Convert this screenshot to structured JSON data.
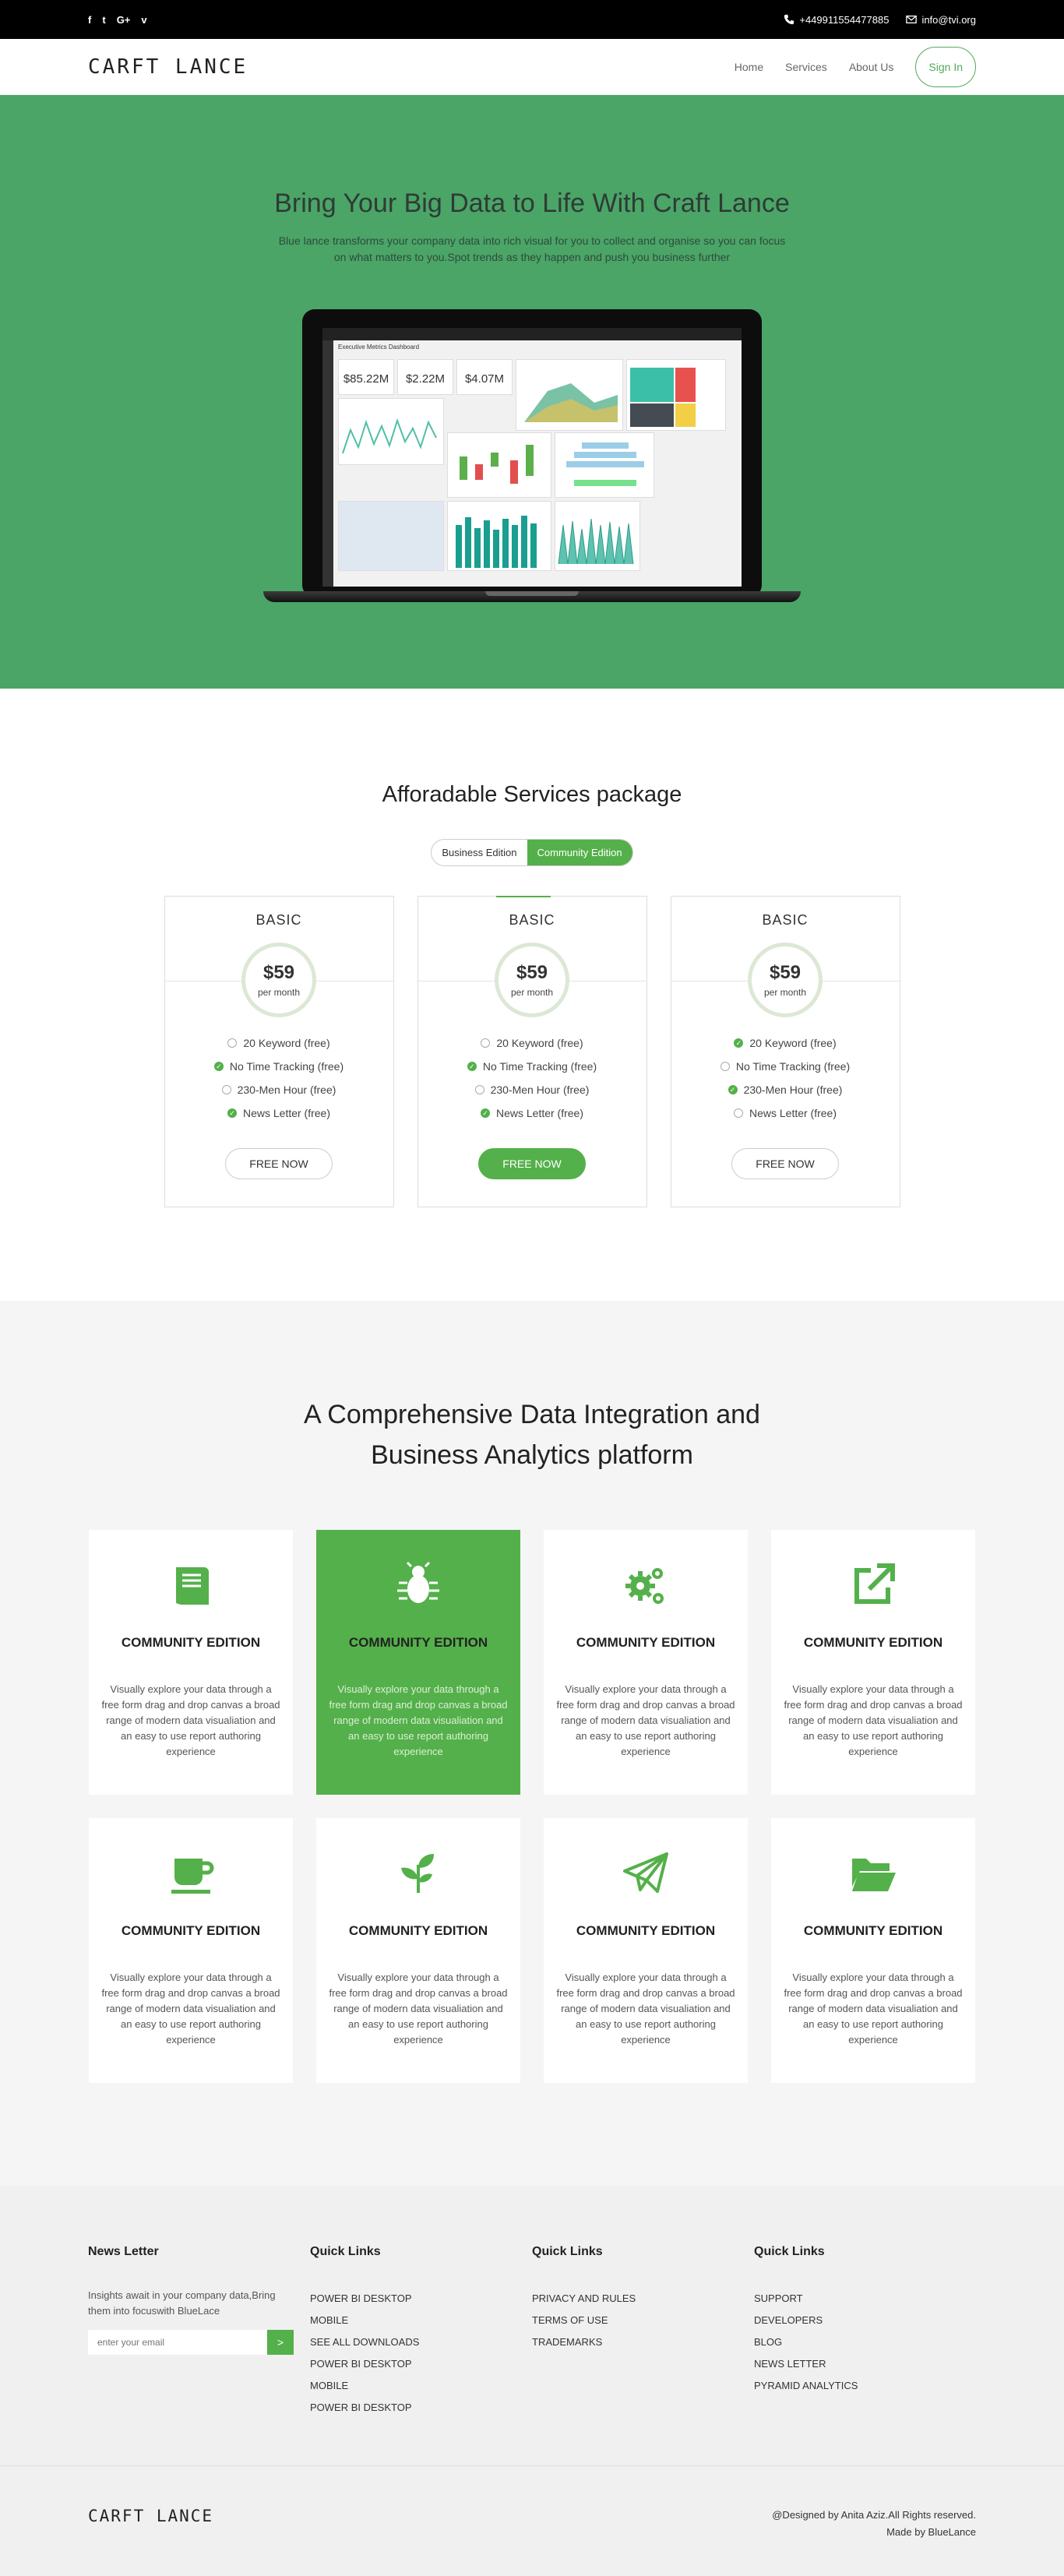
{
  "topbar": {
    "social": [
      {
        "icon": "facebook-icon",
        "glyph": "f"
      },
      {
        "icon": "twitter-icon",
        "glyph": "t"
      },
      {
        "icon": "google-plus-icon",
        "glyph": "G+"
      },
      {
        "icon": "vimeo-icon",
        "glyph": "v"
      }
    ],
    "phone": "+449911554477885",
    "email": "info@tvi.org"
  },
  "nav": {
    "logo": "CARFT LANCE",
    "links": [
      "Home",
      "Services",
      "About Us"
    ],
    "signin": "Sign In"
  },
  "hero": {
    "title": "Bring Your Big Data to Life With Craft Lance",
    "text": "Blue lance transforms your company data into rich visual for you to collect and organise so you can focus on what matters to you.Spot trends as they happen and push you business further",
    "dashboard": {
      "title": "Executive Metrics Dashboard",
      "kpis": [
        "$85.22M",
        "$2.22M",
        "$4.07M"
      ]
    }
  },
  "pricing": {
    "title": "Afforadable Services package",
    "tabs": [
      "Business Edition",
      "Community Edition"
    ],
    "active_tab": 1,
    "plans": [
      {
        "name": "BASIC",
        "price": "$59",
        "period": "per month",
        "features": [
          {
            "text": "20 Keyword (free)",
            "on": false
          },
          {
            "text": "No Time Tracking (free)",
            "on": true
          },
          {
            "text": "230-Men Hour (free)",
            "on": false
          },
          {
            "text": "News Letter (free)",
            "on": true
          }
        ],
        "button": "FREE NOW",
        "featured": false
      },
      {
        "name": "BASIC",
        "price": "$59",
        "period": "per month",
        "features": [
          {
            "text": "20 Keyword (free)",
            "on": false
          },
          {
            "text": "No Time Tracking (free)",
            "on": true
          },
          {
            "text": "230-Men Hour (free)",
            "on": false
          },
          {
            "text": "News Letter (free)",
            "on": true
          }
        ],
        "button": "FREE NOW",
        "featured": true
      },
      {
        "name": "BASIC",
        "price": "$59",
        "period": "per month",
        "features": [
          {
            "text": "20 Keyword (free)",
            "on": true
          },
          {
            "text": "No Time Tracking (free)",
            "on": false
          },
          {
            "text": "230-Men Hour (free)",
            "on": true
          },
          {
            "text": "News Letter (free)",
            "on": false
          }
        ],
        "button": "FREE NOW",
        "featured": false
      }
    ]
  },
  "platform": {
    "title": "A Comprehensive Data Integration and Business Analytics platform",
    "cards": [
      {
        "icon": "book-icon",
        "title": "COMMUNITY EDITION",
        "text": "Visually explore your data through a free form drag and drop canvas a broad range of modern data visualiation and an easy to use report authoring experience",
        "active": false
      },
      {
        "icon": "bug-icon",
        "title": "COMMUNITY EDITION",
        "text": "Visually explore your data through a free form drag and drop canvas a broad range of modern data visualiation and an easy to use report authoring experience",
        "active": true
      },
      {
        "icon": "gears-icon",
        "title": "COMMUNITY EDITION",
        "text": "Visually explore your data through a free form drag and drop canvas a broad range of modern data visualiation and an easy to use report authoring experience",
        "active": false
      },
      {
        "icon": "external-link-icon",
        "title": "COMMUNITY EDITION",
        "text": "Visually explore your data through a free form drag and drop canvas a broad range of modern data visualiation and an easy to use report authoring experience",
        "active": false
      },
      {
        "icon": "coffee-cup-icon",
        "title": "COMMUNITY EDITION",
        "text": "Visually explore your data through a free form drag and drop canvas a broad range of modern data visualiation and an easy to use report authoring experience",
        "active": false
      },
      {
        "icon": "leaf-icon",
        "title": "COMMUNITY EDITION",
        "text": "Visually explore your data through a free form drag and drop canvas a broad range of modern data visualiation and an easy to use report authoring experience",
        "active": false
      },
      {
        "icon": "paper-plane-icon",
        "title": "COMMUNITY EDITION",
        "text": "Visually explore your data through a free form drag and drop canvas a broad range of modern data visualiation and an easy to use report authoring experience",
        "active": false
      },
      {
        "icon": "folder-open-icon",
        "title": "COMMUNITY EDITION",
        "text": "Visually explore your data through a free form drag and drop canvas a broad range of modern data visualiation and an easy to use report authoring experience",
        "active": false
      }
    ]
  },
  "footer": {
    "newsletter": {
      "title": "News Letter",
      "text": "Insights await in your company data,Bring them into focuswith BlueLace",
      "placeholder": "enter your email",
      "button": ">"
    },
    "columns": [
      {
        "title": "Quick Links",
        "links": [
          "POWER BI DESKTOP",
          "MOBILE",
          "SEE ALL DOWNLOADS",
          "POWER BI DESKTOP",
          "MOBILE",
          "POWER BI DESKTOP"
        ]
      },
      {
        "title": "Quick Links",
        "links": [
          "PRIVACY AND RULES",
          "TERMS OF USE",
          "TRADEMARKS"
        ]
      },
      {
        "title": "Quick Links",
        "links": [
          "SUPPORT",
          "DEVELOPERS",
          "BLOG",
          "NEWS LETTER",
          "PYRAMID ANALYTICS"
        ]
      }
    ],
    "logo": "CARFT LANCE",
    "copyright": "@Designed by Anita Aziz.All Rights reserved.",
    "made_by": "Made by BlueLance"
  },
  "colors": {
    "brand_green": "#54b04a",
    "hero_green": "#4aa567",
    "top_bar": "#000000"
  }
}
